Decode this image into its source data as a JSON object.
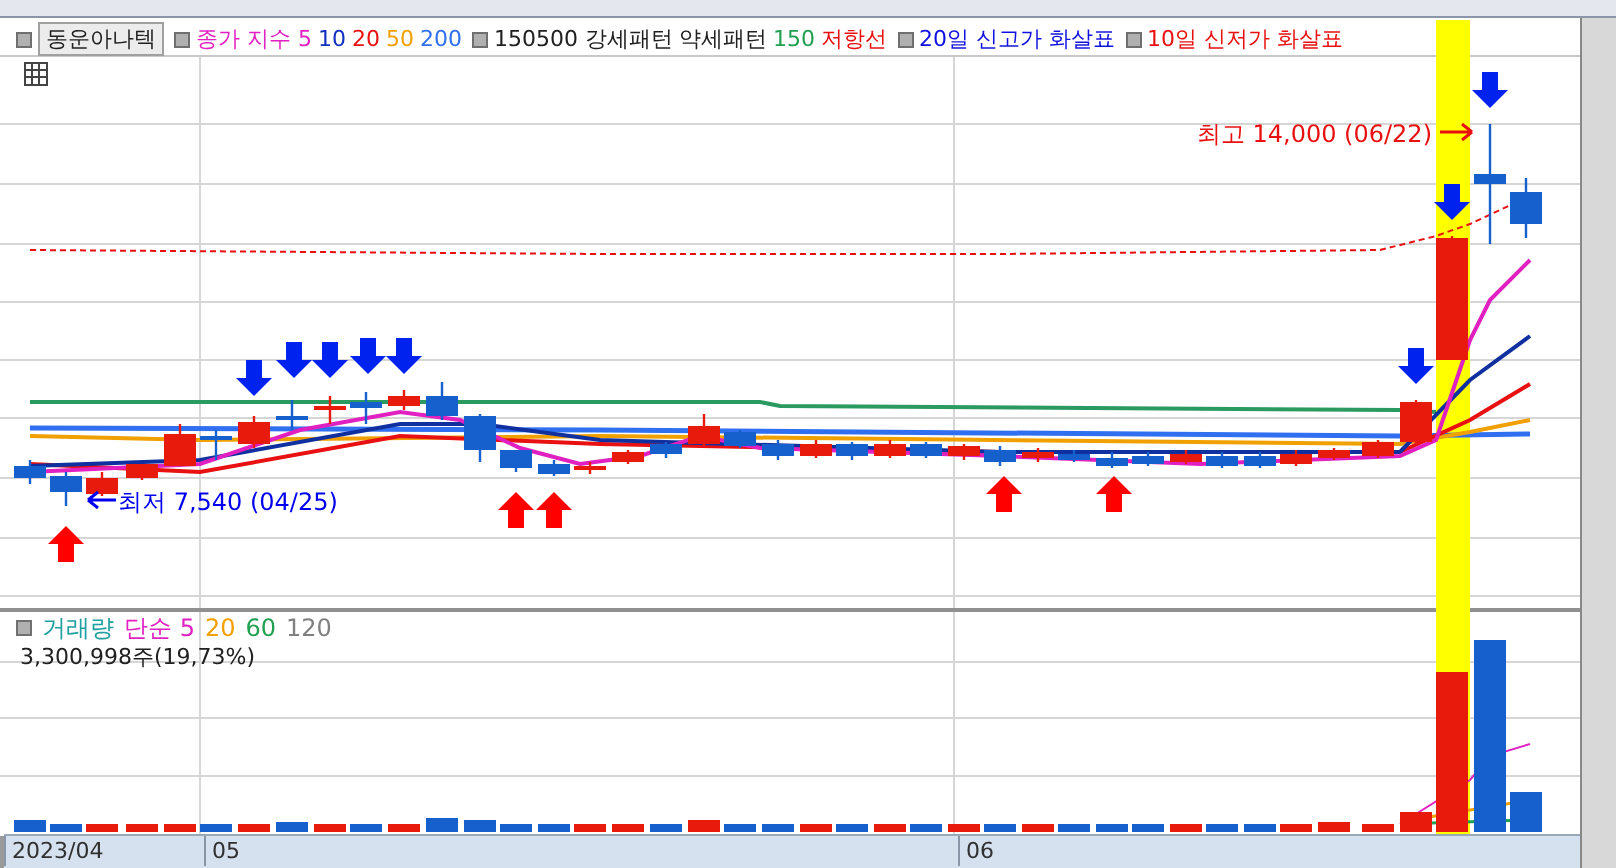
{
  "stock_button": "동운아나텍",
  "legend_groups": [
    {
      "items": [
        {
          "text": "종가 지수 5",
          "color": "#e020c0"
        },
        {
          "text": "10",
          "color": "#1030c0"
        },
        {
          "text": "20",
          "color": "#e81010"
        },
        {
          "text": "50",
          "color": "#f0a000"
        },
        {
          "text": "200",
          "color": "#3070f0"
        }
      ]
    },
    {
      "items": [
        {
          "text": "150500 강세패턴",
          "color": "#202020"
        },
        {
          "text": "약세패턴",
          "color": "#202020"
        },
        {
          "text": "150",
          "color": "#20a050"
        },
        {
          "text": "저항선",
          "color": "#e81010"
        }
      ]
    },
    {
      "items": [
        {
          "text": "20일 신고가 화살표",
          "color": "#1010e0"
        }
      ]
    },
    {
      "items": [
        {
          "text": "10일 신저가 화살표",
          "color": "#e81010"
        }
      ]
    }
  ],
  "annotations": [
    {
      "kind": "low",
      "text": "최저 7,540 (04/25)"
    },
    {
      "kind": "high",
      "text": "최고 14,000 (06/22)"
    }
  ],
  "volume_legend": [
    {
      "text": "거래량",
      "color": "#20a0a0"
    },
    {
      "text": "단순 5",
      "color": "#e020c0"
    },
    {
      "text": "20",
      "color": "#f0a000"
    },
    {
      "text": "60",
      "color": "#20a050"
    },
    {
      "text": "120",
      "color": "#808080"
    }
  ],
  "volume_readout": "3,300,998주(19,73%)",
  "x_axis": [
    "2023/04",
    "05",
    "06"
  ]
}
